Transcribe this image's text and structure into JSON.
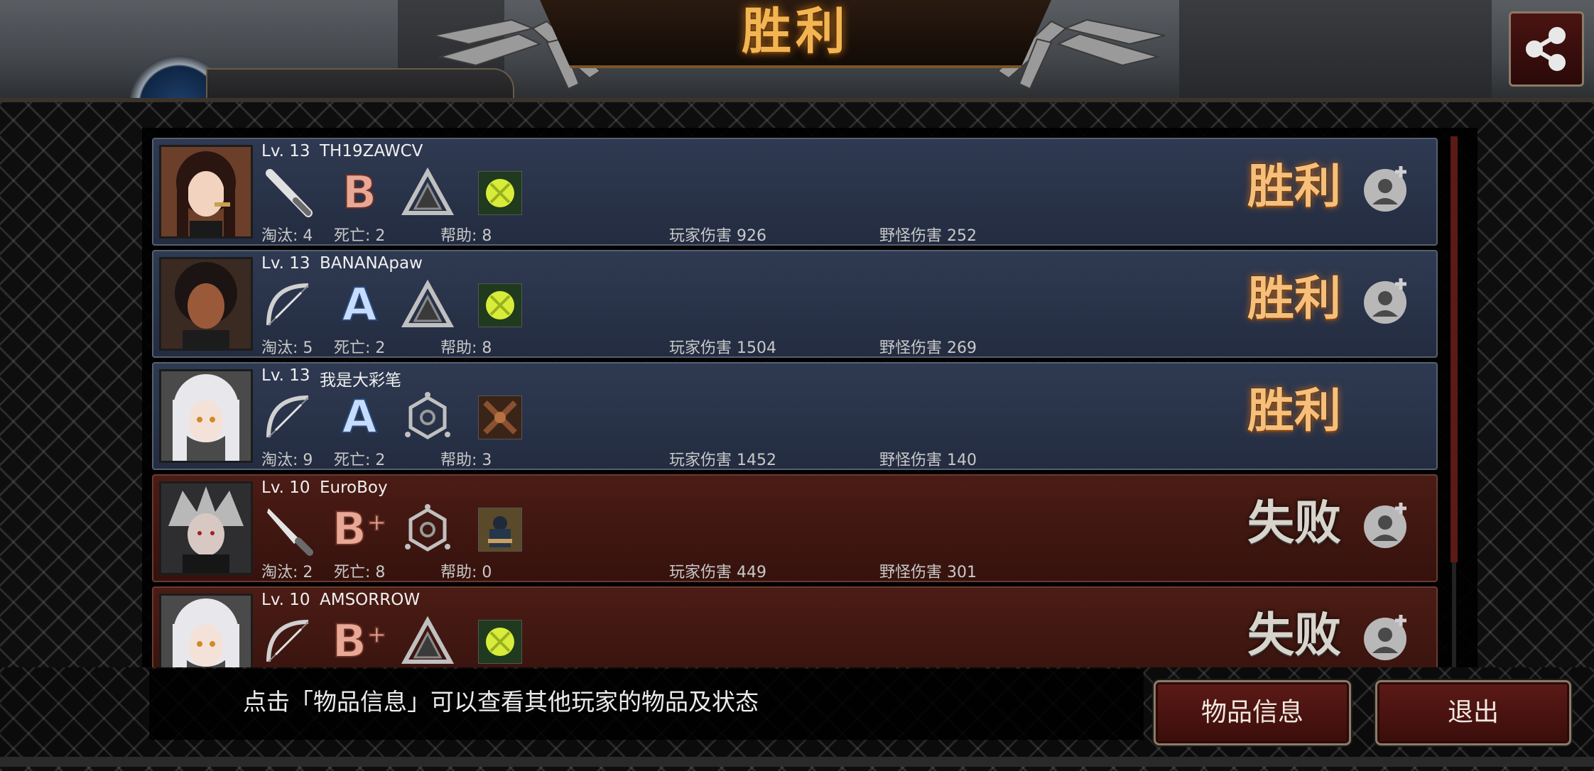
{
  "title": "胜利",
  "players": [
    {
      "level": "Lv. 13",
      "name": "TH19ZAWCV",
      "weapon": "bat-icon",
      "grade": "B",
      "grade_plus": "",
      "role": "triangle-icon",
      "gem": "yellow-gem-icon",
      "kills_label": "淘汰: 4",
      "deaths_label": "死亡: 2",
      "assists_label": "帮助: 8",
      "player_dmg": "玩家伤害 926",
      "monster_dmg": "野怪伤害 252",
      "result": "胜利",
      "outcome": "win",
      "friend": true
    },
    {
      "level": "Lv. 13",
      "name": "BANANApaw",
      "weapon": "bow-icon",
      "grade": "A",
      "grade_plus": "",
      "role": "triangle-icon",
      "gem": "yellow-gem-icon",
      "kills_label": "淘汰: 5",
      "deaths_label": "死亡: 2",
      "assists_label": "帮助: 8",
      "player_dmg": "玩家伤害 1504",
      "monster_dmg": "野怪伤害 269",
      "result": "胜利",
      "outcome": "win",
      "friend": true
    },
    {
      "level": "Lv. 13",
      "name": "我是大彩笔",
      "weapon": "bow-icon",
      "grade": "A",
      "grade_plus": "",
      "role": "hexagon-icon",
      "gem": "crossed-item-icon",
      "kills_label": "淘汰: 9",
      "deaths_label": "死亡: 2",
      "assists_label": "帮助: 3",
      "player_dmg": "玩家伤害 1452",
      "monster_dmg": "野怪伤害 140",
      "result": "胜利",
      "outcome": "win",
      "friend": false
    },
    {
      "level": "Lv. 10",
      "name": "EuroBoy",
      "weapon": "knife-icon",
      "grade": "B",
      "grade_plus": "+",
      "role": "hexagon-icon",
      "gem": "character-item-icon",
      "kills_label": "淘汰: 2",
      "deaths_label": "死亡: 8",
      "assists_label": "帮助: 0",
      "player_dmg": "玩家伤害 449",
      "monster_dmg": "野怪伤害 301",
      "result": "失败",
      "outcome": "lose",
      "friend": true
    },
    {
      "level": "Lv. 10",
      "name": "AMSORROW",
      "weapon": "bow-icon",
      "grade": "B",
      "grade_plus": "+",
      "role": "triangle-icon",
      "gem": "yellow-gem-icon",
      "kills_label": "",
      "deaths_label": "",
      "assists_label": "",
      "player_dmg": "",
      "monster_dmg": "",
      "result": "失败",
      "outcome": "lose",
      "friend": true
    }
  ],
  "tip": "点击「物品信息」可以查看其他玩家的物品及状态",
  "buttons": {
    "items": "物品信息",
    "quit": "退出"
  },
  "colors": {
    "win_text": "#f6c07a",
    "lose_text": "#d8d4cc",
    "win_row": "#2a3449",
    "lose_row": "#41180f",
    "button": "#4a1412"
  }
}
